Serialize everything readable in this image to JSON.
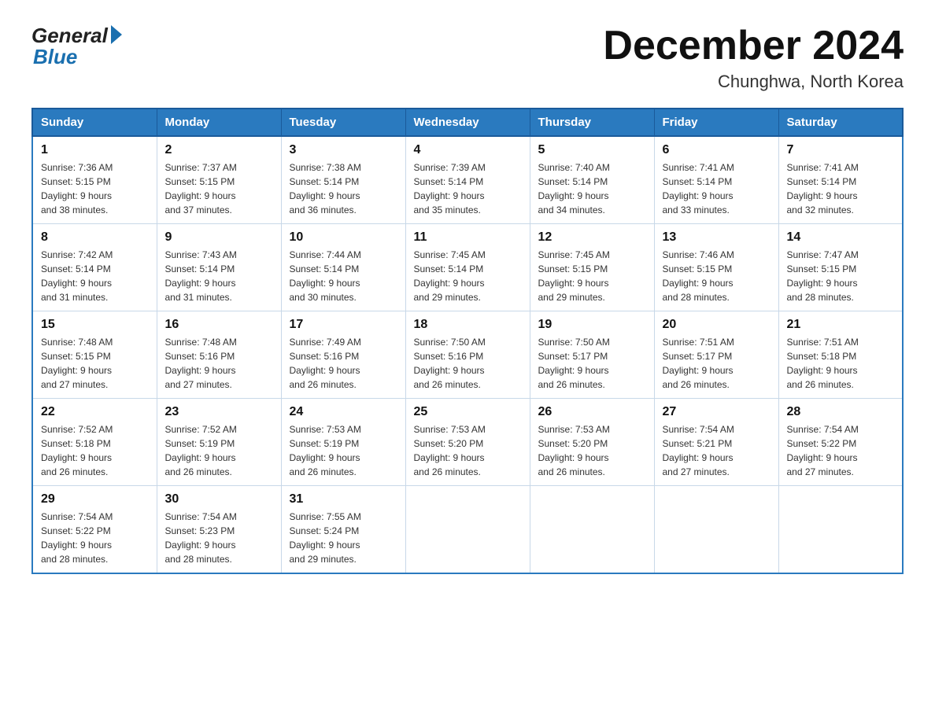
{
  "logo": {
    "general": "General",
    "blue": "Blue"
  },
  "title": "December 2024",
  "subtitle": "Chunghwa, North Korea",
  "headers": [
    "Sunday",
    "Monday",
    "Tuesday",
    "Wednesday",
    "Thursday",
    "Friday",
    "Saturday"
  ],
  "weeks": [
    [
      {
        "day": "1",
        "sunrise": "7:36 AM",
        "sunset": "5:15 PM",
        "daylight": "9 hours and 38 minutes."
      },
      {
        "day": "2",
        "sunrise": "7:37 AM",
        "sunset": "5:15 PM",
        "daylight": "9 hours and 37 minutes."
      },
      {
        "day": "3",
        "sunrise": "7:38 AM",
        "sunset": "5:14 PM",
        "daylight": "9 hours and 36 minutes."
      },
      {
        "day": "4",
        "sunrise": "7:39 AM",
        "sunset": "5:14 PM",
        "daylight": "9 hours and 35 minutes."
      },
      {
        "day": "5",
        "sunrise": "7:40 AM",
        "sunset": "5:14 PM",
        "daylight": "9 hours and 34 minutes."
      },
      {
        "day": "6",
        "sunrise": "7:41 AM",
        "sunset": "5:14 PM",
        "daylight": "9 hours and 33 minutes."
      },
      {
        "day": "7",
        "sunrise": "7:41 AM",
        "sunset": "5:14 PM",
        "daylight": "9 hours and 32 minutes."
      }
    ],
    [
      {
        "day": "8",
        "sunrise": "7:42 AM",
        "sunset": "5:14 PM",
        "daylight": "9 hours and 31 minutes."
      },
      {
        "day": "9",
        "sunrise": "7:43 AM",
        "sunset": "5:14 PM",
        "daylight": "9 hours and 31 minutes."
      },
      {
        "day": "10",
        "sunrise": "7:44 AM",
        "sunset": "5:14 PM",
        "daylight": "9 hours and 30 minutes."
      },
      {
        "day": "11",
        "sunrise": "7:45 AM",
        "sunset": "5:14 PM",
        "daylight": "9 hours and 29 minutes."
      },
      {
        "day": "12",
        "sunrise": "7:45 AM",
        "sunset": "5:15 PM",
        "daylight": "9 hours and 29 minutes."
      },
      {
        "day": "13",
        "sunrise": "7:46 AM",
        "sunset": "5:15 PM",
        "daylight": "9 hours and 28 minutes."
      },
      {
        "day": "14",
        "sunrise": "7:47 AM",
        "sunset": "5:15 PM",
        "daylight": "9 hours and 28 minutes."
      }
    ],
    [
      {
        "day": "15",
        "sunrise": "7:48 AM",
        "sunset": "5:15 PM",
        "daylight": "9 hours and 27 minutes."
      },
      {
        "day": "16",
        "sunrise": "7:48 AM",
        "sunset": "5:16 PM",
        "daylight": "9 hours and 27 minutes."
      },
      {
        "day": "17",
        "sunrise": "7:49 AM",
        "sunset": "5:16 PM",
        "daylight": "9 hours and 26 minutes."
      },
      {
        "day": "18",
        "sunrise": "7:50 AM",
        "sunset": "5:16 PM",
        "daylight": "9 hours and 26 minutes."
      },
      {
        "day": "19",
        "sunrise": "7:50 AM",
        "sunset": "5:17 PM",
        "daylight": "9 hours and 26 minutes."
      },
      {
        "day": "20",
        "sunrise": "7:51 AM",
        "sunset": "5:17 PM",
        "daylight": "9 hours and 26 minutes."
      },
      {
        "day": "21",
        "sunrise": "7:51 AM",
        "sunset": "5:18 PM",
        "daylight": "9 hours and 26 minutes."
      }
    ],
    [
      {
        "day": "22",
        "sunrise": "7:52 AM",
        "sunset": "5:18 PM",
        "daylight": "9 hours and 26 minutes."
      },
      {
        "day": "23",
        "sunrise": "7:52 AM",
        "sunset": "5:19 PM",
        "daylight": "9 hours and 26 minutes."
      },
      {
        "day": "24",
        "sunrise": "7:53 AM",
        "sunset": "5:19 PM",
        "daylight": "9 hours and 26 minutes."
      },
      {
        "day": "25",
        "sunrise": "7:53 AM",
        "sunset": "5:20 PM",
        "daylight": "9 hours and 26 minutes."
      },
      {
        "day": "26",
        "sunrise": "7:53 AM",
        "sunset": "5:20 PM",
        "daylight": "9 hours and 26 minutes."
      },
      {
        "day": "27",
        "sunrise": "7:54 AM",
        "sunset": "5:21 PM",
        "daylight": "9 hours and 27 minutes."
      },
      {
        "day": "28",
        "sunrise": "7:54 AM",
        "sunset": "5:22 PM",
        "daylight": "9 hours and 27 minutes."
      }
    ],
    [
      {
        "day": "29",
        "sunrise": "7:54 AM",
        "sunset": "5:22 PM",
        "daylight": "9 hours and 28 minutes."
      },
      {
        "day": "30",
        "sunrise": "7:54 AM",
        "sunset": "5:23 PM",
        "daylight": "9 hours and 28 minutes."
      },
      {
        "day": "31",
        "sunrise": "7:55 AM",
        "sunset": "5:24 PM",
        "daylight": "9 hours and 29 minutes."
      },
      null,
      null,
      null,
      null
    ]
  ],
  "sunrise_label": "Sunrise:",
  "sunset_label": "Sunset:",
  "daylight_label": "Daylight:"
}
